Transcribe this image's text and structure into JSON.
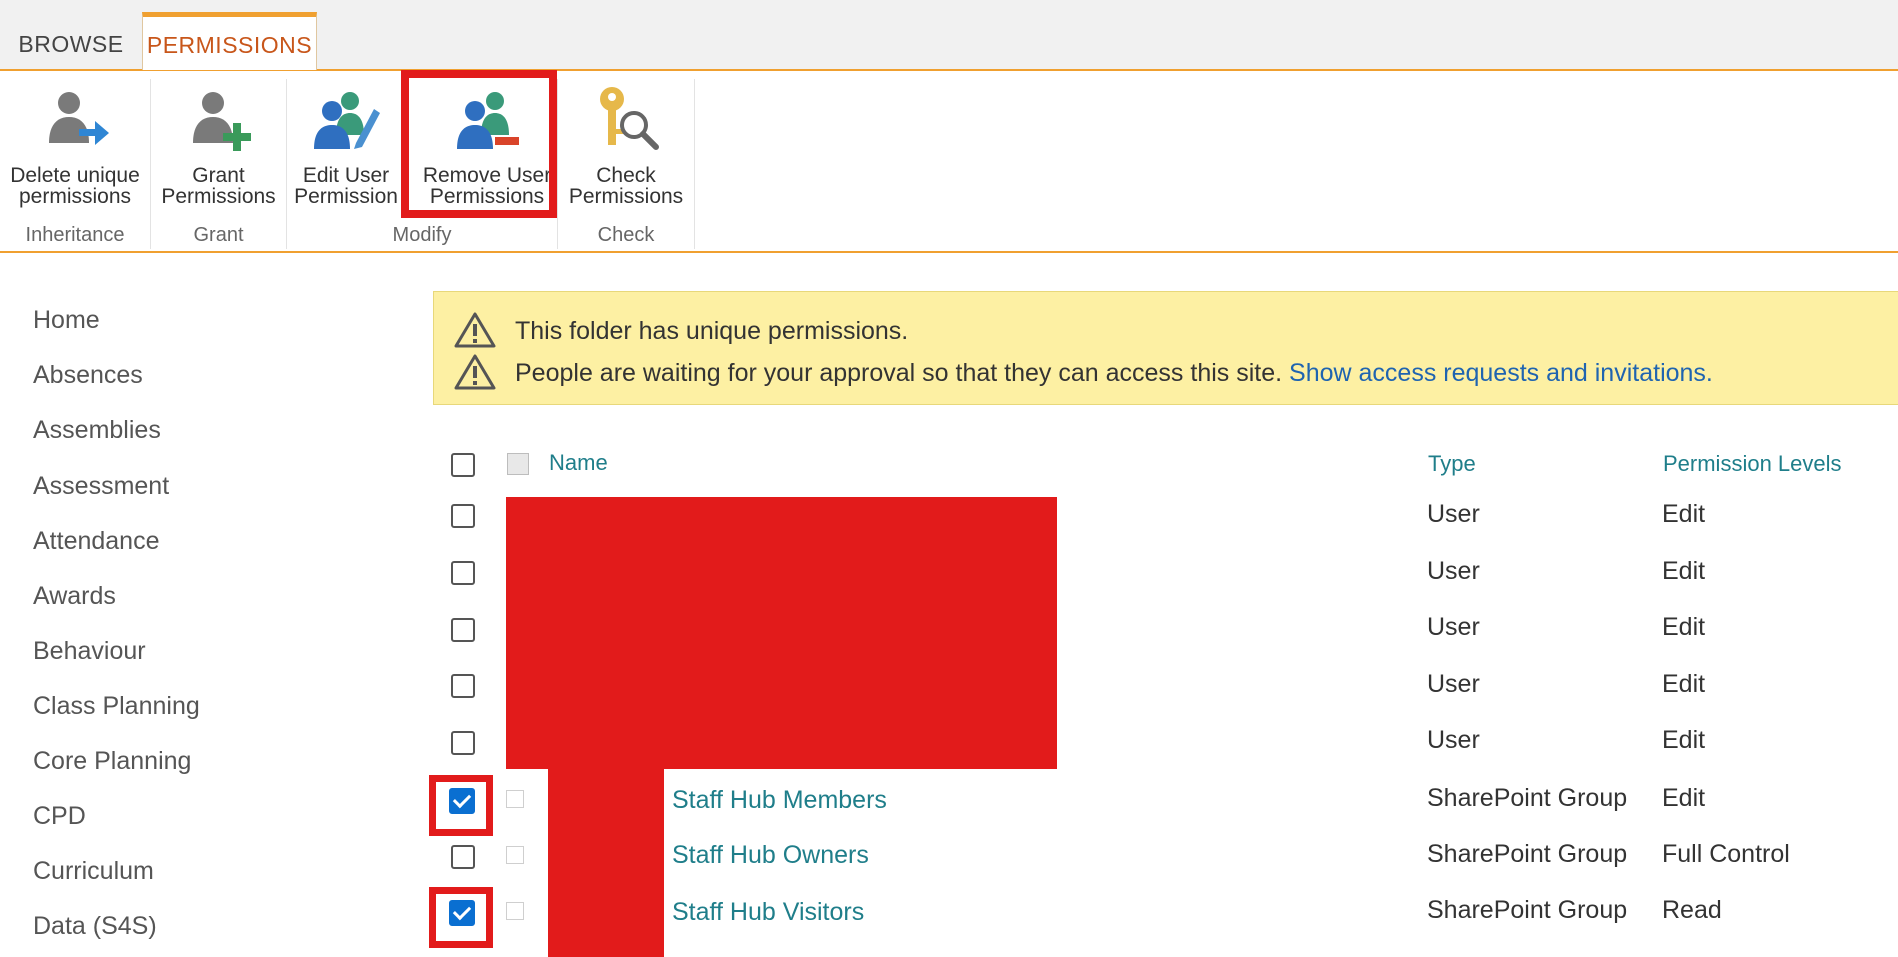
{
  "tabs": {
    "browse": "BROWSE",
    "permissions": "PERMISSIONS"
  },
  "ribbon": {
    "groups": {
      "inheritance": "Inheritance",
      "grant": "Grant",
      "modify": "Modify",
      "check": "Check"
    },
    "buttons": {
      "delete_unique": "Delete unique\npermissions",
      "grant_permissions": "Grant\nPermissions",
      "edit_user": "Edit User\nPermission",
      "remove_user": "Remove User\nPermissions",
      "check_permissions": "Check\nPermissions"
    },
    "icons": {
      "delete_unique": "user-arrow-icon",
      "grant_permissions": "user-plus-icon",
      "edit_user": "users-pencil-icon",
      "remove_user": "users-minus-icon",
      "check_permissions": "key-magnifier-icon"
    }
  },
  "nav": [
    "Home",
    "Absences",
    "Assemblies",
    "Assessment",
    "Attendance",
    "Awards",
    "Behaviour",
    "Class Planning",
    "Core Planning",
    "CPD",
    "Curriculum",
    "Data (S4S)"
  ],
  "notice": {
    "line1": "This folder has unique permissions.",
    "line2": "People are waiting for your approval so that they can access this site.",
    "link": "Show access requests and invitations."
  },
  "table": {
    "headers": {
      "name": "Name",
      "type": "Type",
      "levels": "Permission Levels"
    },
    "rows": [
      {
        "name": "",
        "type": "User",
        "level": "Edit",
        "checked": false
      },
      {
        "name": "",
        "type": "User",
        "level": "Edit",
        "checked": false
      },
      {
        "name": "",
        "type": "User",
        "level": "Edit",
        "checked": false
      },
      {
        "name": "",
        "type": "User",
        "level": "Edit",
        "checked": false
      },
      {
        "name": "",
        "type": "User",
        "level": "Edit",
        "checked": false
      },
      {
        "name": "Staff Hub Members",
        "type": "SharePoint Group",
        "level": "Edit",
        "checked": true
      },
      {
        "name": "Staff Hub Owners",
        "type": "SharePoint Group",
        "level": "Full Control",
        "checked": false
      },
      {
        "name": "Staff Hub Visitors",
        "type": "SharePoint Group",
        "level": "Read",
        "checked": true
      }
    ]
  },
  "colors": {
    "accent": "#f0a030",
    "tab_active": "#c8561a",
    "link": "#1f7e8a",
    "notice_bg": "#fdf0a3",
    "highlight": "#e21b1b",
    "checkbox": "#0a6fd1"
  }
}
